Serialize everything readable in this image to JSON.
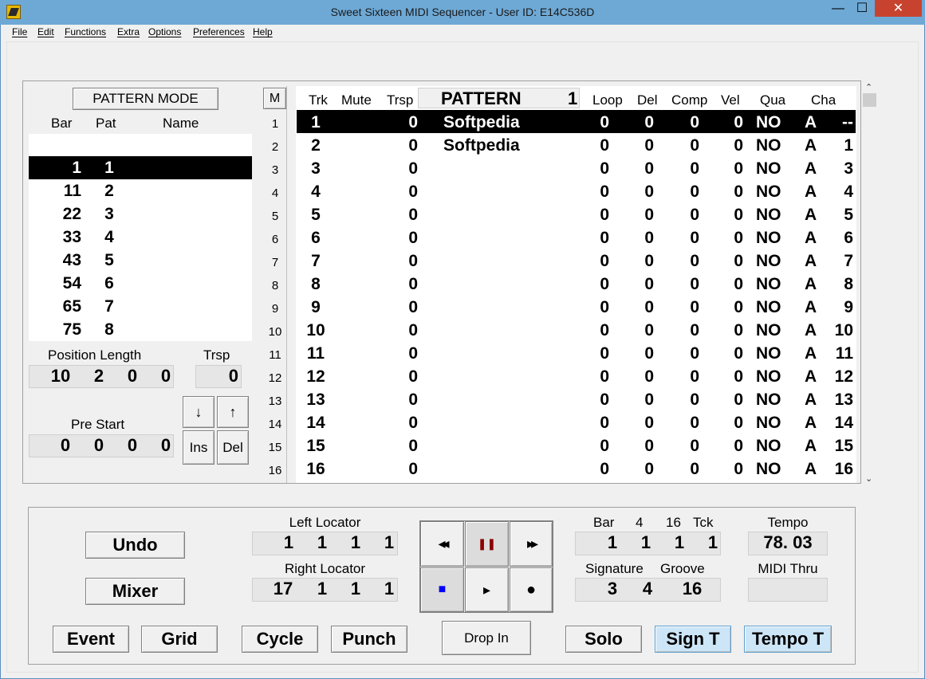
{
  "window": {
    "title": "Sweet Sixteen MIDI Sequencer - User ID: E14C536D",
    "minimize": "—",
    "maximize": "☐",
    "close": "✕"
  },
  "menu": [
    "File",
    "Edit",
    "Functions",
    "Extra",
    "Options",
    "Preferences",
    "Help"
  ],
  "left": {
    "mode_button": "PATTERN MODE",
    "col_bar": "Bar",
    "col_pat": "Pat",
    "col_name": "Name",
    "rows": [
      {
        "bar": "1",
        "pat": "1"
      },
      {
        "bar": "11",
        "pat": "2"
      },
      {
        "bar": "22",
        "pat": "3"
      },
      {
        "bar": "33",
        "pat": "4"
      },
      {
        "bar": "43",
        "pat": "5"
      },
      {
        "bar": "54",
        "pat": "6"
      },
      {
        "bar": "65",
        "pat": "7"
      },
      {
        "bar": "75",
        "pat": "8"
      }
    ],
    "position_length_label": "Position Length",
    "trsp_label": "Trsp",
    "position_length": [
      "10",
      "2",
      "0",
      "0"
    ],
    "trsp_value": "0",
    "pre_start_label": "Pre Start",
    "pre_start": [
      "0",
      "0",
      "0",
      "0"
    ],
    "btn_down": "↓",
    "btn_up": "↑",
    "btn_ins": "Ins",
    "btn_del": "Del"
  },
  "tracks": {
    "m_button": "M",
    "headers": {
      "trk": "Trk",
      "mute": "Mute",
      "trsp": "Trsp",
      "pattern": "PATTERN",
      "pattern_num": "1",
      "loop": "Loop",
      "del": "Del",
      "comp": "Comp",
      "vel": "Vel",
      "qua": "Qua",
      "cha": "Cha"
    },
    "rows": [
      {
        "n": "1",
        "trk": "1",
        "trsp": "0",
        "name": "Softpedia",
        "loop": "0",
        "del": "0",
        "comp": "0",
        "vel": "0",
        "qua": "NO",
        "a": "A",
        "cha": "--"
      },
      {
        "n": "2",
        "trk": "2",
        "trsp": "0",
        "name": "Softpedia",
        "loop": "0",
        "del": "0",
        "comp": "0",
        "vel": "0",
        "qua": "NO",
        "a": "A",
        "cha": "1"
      },
      {
        "n": "3",
        "trk": "3",
        "trsp": "0",
        "name": "",
        "loop": "0",
        "del": "0",
        "comp": "0",
        "vel": "0",
        "qua": "NO",
        "a": "A",
        "cha": "3"
      },
      {
        "n": "4",
        "trk": "4",
        "trsp": "0",
        "name": "",
        "loop": "0",
        "del": "0",
        "comp": "0",
        "vel": "0",
        "qua": "NO",
        "a": "A",
        "cha": "4"
      },
      {
        "n": "5",
        "trk": "5",
        "trsp": "0",
        "name": "",
        "loop": "0",
        "del": "0",
        "comp": "0",
        "vel": "0",
        "qua": "NO",
        "a": "A",
        "cha": "5"
      },
      {
        "n": "6",
        "trk": "6",
        "trsp": "0",
        "name": "",
        "loop": "0",
        "del": "0",
        "comp": "0",
        "vel": "0",
        "qua": "NO",
        "a": "A",
        "cha": "6"
      },
      {
        "n": "7",
        "trk": "7",
        "trsp": "0",
        "name": "",
        "loop": "0",
        "del": "0",
        "comp": "0",
        "vel": "0",
        "qua": "NO",
        "a": "A",
        "cha": "7"
      },
      {
        "n": "8",
        "trk": "8",
        "trsp": "0",
        "name": "",
        "loop": "0",
        "del": "0",
        "comp": "0",
        "vel": "0",
        "qua": "NO",
        "a": "A",
        "cha": "8"
      },
      {
        "n": "9",
        "trk": "9",
        "trsp": "0",
        "name": "",
        "loop": "0",
        "del": "0",
        "comp": "0",
        "vel": "0",
        "qua": "NO",
        "a": "A",
        "cha": "9"
      },
      {
        "n": "10",
        "trk": "10",
        "trsp": "0",
        "name": "",
        "loop": "0",
        "del": "0",
        "comp": "0",
        "vel": "0",
        "qua": "NO",
        "a": "A",
        "cha": "10"
      },
      {
        "n": "11",
        "trk": "11",
        "trsp": "0",
        "name": "",
        "loop": "0",
        "del": "0",
        "comp": "0",
        "vel": "0",
        "qua": "NO",
        "a": "A",
        "cha": "11"
      },
      {
        "n": "12",
        "trk": "12",
        "trsp": "0",
        "name": "",
        "loop": "0",
        "del": "0",
        "comp": "0",
        "vel": "0",
        "qua": "NO",
        "a": "A",
        "cha": "12"
      },
      {
        "n": "13",
        "trk": "13",
        "trsp": "0",
        "name": "",
        "loop": "0",
        "del": "0",
        "comp": "0",
        "vel": "0",
        "qua": "NO",
        "a": "A",
        "cha": "13"
      },
      {
        "n": "14",
        "trk": "14",
        "trsp": "0",
        "name": "",
        "loop": "0",
        "del": "0",
        "comp": "0",
        "vel": "0",
        "qua": "NO",
        "a": "A",
        "cha": "14"
      },
      {
        "n": "15",
        "trk": "15",
        "trsp": "0",
        "name": "",
        "loop": "0",
        "del": "0",
        "comp": "0",
        "vel": "0",
        "qua": "NO",
        "a": "A",
        "cha": "15"
      },
      {
        "n": "16",
        "trk": "16",
        "trsp": "0",
        "name": "",
        "loop": "0",
        "del": "0",
        "comp": "0",
        "vel": "0",
        "qua": "NO",
        "a": "A",
        "cha": "16"
      }
    ]
  },
  "bottom": {
    "undo": "Undo",
    "mixer": "Mixer",
    "left_locator_label": "Left Locator",
    "left_locator": [
      "1",
      "1",
      "1",
      "1"
    ],
    "right_locator_label": "Right Locator",
    "right_locator": [
      "17",
      "1",
      "1",
      "1"
    ],
    "rewind_icon": "◂◂",
    "pause_icon": "❚❚",
    "ff_icon": "▸▸",
    "stop_icon": "■",
    "play_icon": "▸",
    "record_icon": "●",
    "drop_in": "Drop In",
    "pos_labels": [
      "Bar",
      "4",
      "16",
      "Tck"
    ],
    "pos_values": [
      "1",
      "1",
      "1",
      "1"
    ],
    "signature_label": "Signature",
    "groove_label": "Groove",
    "signature_values": [
      "3",
      "4"
    ],
    "groove_value": "16",
    "tempo_label": "Tempo",
    "tempo_value": "78. 03",
    "midi_thru_label": "MIDI Thru",
    "midi_thru_value": "",
    "event": "Event",
    "grid": "Grid",
    "cycle": "Cycle",
    "punch": "Punch",
    "solo": "Solo",
    "sign_t": "Sign T",
    "tempo_t": "Tempo T",
    "colors": {
      "accent_button": "#cde6f7",
      "pause": "#8b0000",
      "stop": "#0000ff"
    }
  }
}
